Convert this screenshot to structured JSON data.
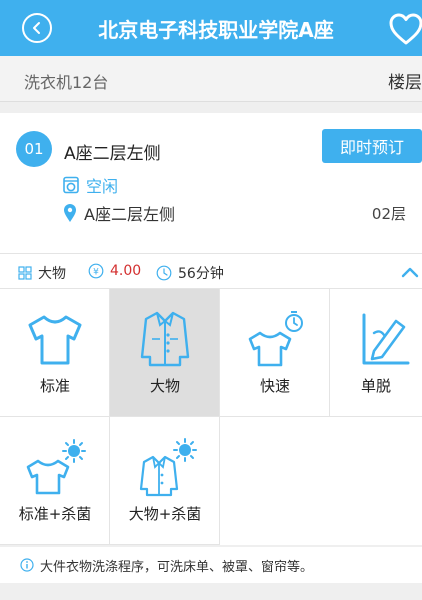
{
  "header": {
    "title": "北京电子科技职业学院A座"
  },
  "toolbar": {
    "count_label": "洗衣机12台",
    "floor_filter": "楼层"
  },
  "machine": {
    "number": "01",
    "name": "A座二层左侧",
    "reserve_label": "即时预订",
    "status": "空闲",
    "location": "A座二层左侧",
    "floor": "02层"
  },
  "program_info": {
    "mode": "大物",
    "price": "4.00",
    "duration": "56分钟"
  },
  "programs": [
    {
      "label": "标准",
      "icon": "tshirt-icon",
      "selected": false
    },
    {
      "label": "大物",
      "icon": "coat-icon",
      "selected": true
    },
    {
      "label": "快速",
      "icon": "tshirt-timer-icon",
      "selected": false
    },
    {
      "label": "单脱",
      "icon": "spin-dry-icon",
      "selected": false
    },
    {
      "label": "标准+杀菌",
      "icon": "tshirt-germ-icon",
      "selected": false
    },
    {
      "label": "大物+杀菌",
      "icon": "coat-germ-icon",
      "selected": false
    }
  ],
  "tip": {
    "text": "大件衣物洗涤程序，可洗床单、被罩、窗帘等。"
  },
  "colors": {
    "accent": "#3fb0ee",
    "price": "#d32f2f",
    "selected_bg": "#dedede"
  }
}
